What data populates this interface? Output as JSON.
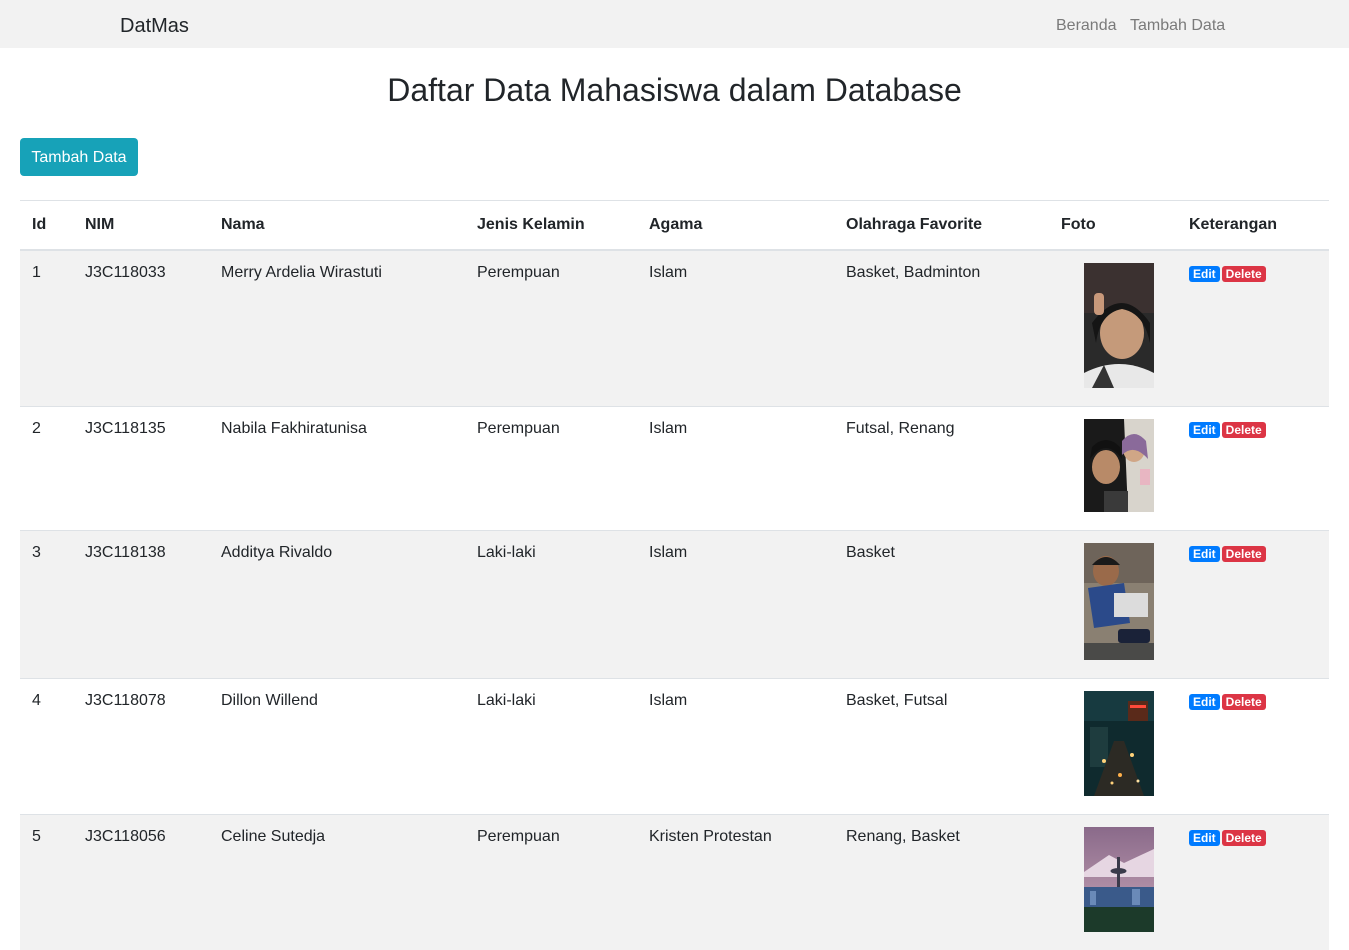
{
  "nav": {
    "brand": "DatMas",
    "links": [
      "Beranda",
      "Tambah Data"
    ]
  },
  "page": {
    "title": "Daftar Data Mahasiswa dalam Database",
    "add_button": "Tambah Data"
  },
  "table": {
    "headers": [
      "Id",
      "NIM",
      "Nama",
      "Jenis Kelamin",
      "Agama",
      "Olahraga Favorite",
      "Foto",
      "Keterangan"
    ],
    "actions": {
      "edit": "Edit",
      "delete": "Delete"
    },
    "rows": [
      {
        "id": "1",
        "nim": "J3C118033",
        "nama": "Merry Ardelia Wirastuti",
        "jk": "Perempuan",
        "agama": "Islam",
        "olahraga": "Basket, Badminton"
      },
      {
        "id": "2",
        "nim": "J3C118135",
        "nama": "Nabila Fakhiratunisa",
        "jk": "Perempuan",
        "agama": "Islam",
        "olahraga": "Futsal, Renang"
      },
      {
        "id": "3",
        "nim": "J3C118138",
        "nama": "Additya Rivaldo",
        "jk": "Laki-laki",
        "agama": "Islam",
        "olahraga": "Basket"
      },
      {
        "id": "4",
        "nim": "J3C118078",
        "nama": "Dillon Willend",
        "jk": "Laki-laki",
        "agama": "Islam",
        "olahraga": "Basket, Futsal"
      },
      {
        "id": "5",
        "nim": "J3C118056",
        "nama": "Celine Sutedja",
        "jk": "Perempuan",
        "agama": "Kristen Protestan",
        "olahraga": "Renang, Basket"
      }
    ]
  },
  "colors": {
    "accent": "#17a2b8",
    "edit": "#007bff",
    "delete": "#dc3545",
    "stripe": "#f2f2f2"
  }
}
